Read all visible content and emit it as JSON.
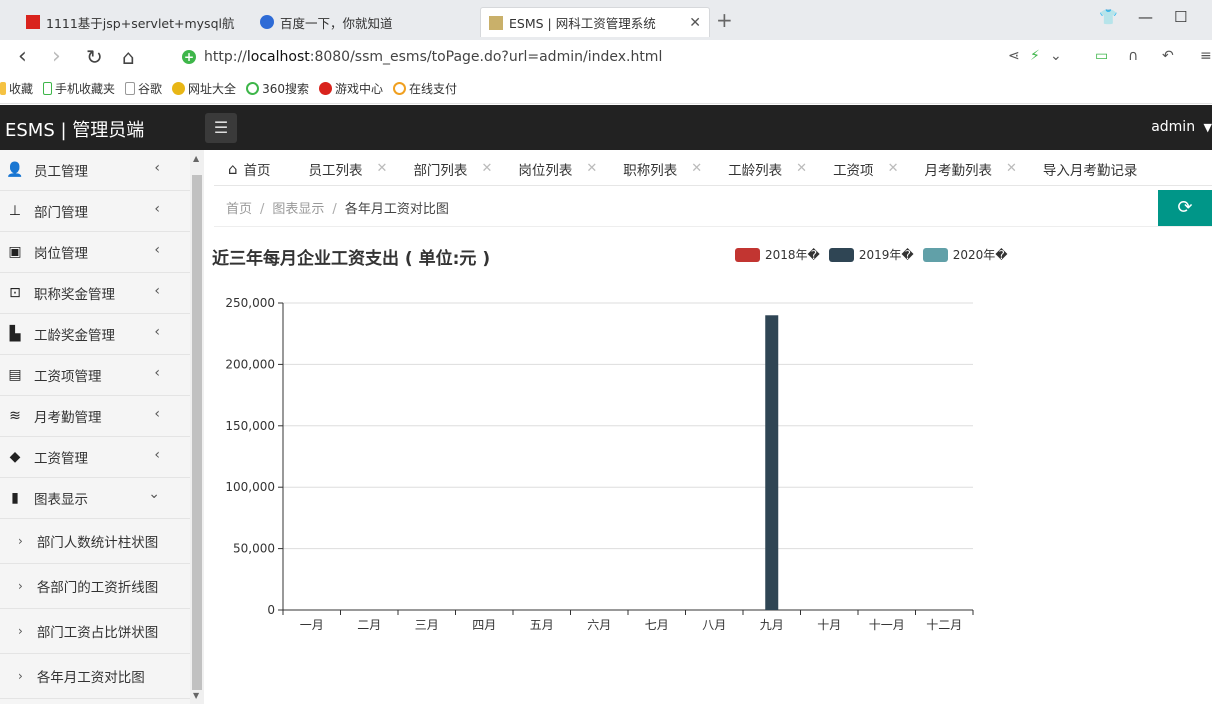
{
  "browser": {
    "tabs": [
      {
        "title": "1111基于jsp+servlet+mysql航"
      },
      {
        "title": "百度一下，你就知道"
      },
      {
        "title": "ESMS | 网科工资管理系统"
      }
    ],
    "url_prefix": "http://",
    "url_host": "localhost",
    "url_rest": ":8080/ssm_esms/toPage.do?url=admin/index.html",
    "bookmarks": [
      "收藏",
      "手机收藏夹",
      "谷歌",
      "网址大全",
      "360搜索",
      "游戏中心",
      "在线支付"
    ]
  },
  "app": {
    "brand": "ESMS | 管理员端",
    "user": "admin"
  },
  "sidebar": {
    "items": [
      {
        "label": "员工管理",
        "icon": "users-icon"
      },
      {
        "label": "部门管理",
        "icon": "sitemap-icon"
      },
      {
        "label": "岗位管理",
        "icon": "id-card-icon"
      },
      {
        "label": "职称奖金管理",
        "icon": "briefcase-icon"
      },
      {
        "label": "工龄奖金管理",
        "icon": "building-icon"
      },
      {
        "label": "工资项管理",
        "icon": "newspaper-icon"
      },
      {
        "label": "月考勤管理",
        "icon": "layers-icon"
      },
      {
        "label": "工资管理",
        "icon": "tag-icon"
      },
      {
        "label": "图表显示",
        "icon": "book-icon"
      }
    ],
    "subitems": [
      "部门人数统计柱状图",
      "各部门的工资折线图",
      "部门工资占比饼状图",
      "各年月工资对比图"
    ]
  },
  "content_tabs": [
    "首页",
    "员工列表",
    "部门列表",
    "岗位列表",
    "职称列表",
    "工龄列表",
    "工资项",
    "月考勤列表",
    "导入月考勤记录"
  ],
  "breadcrumb": {
    "home": "首页",
    "section": "图表显示",
    "current": "各年月工资对比图"
  },
  "chart_data": {
    "type": "bar",
    "title": "近三年每月企业工资支出 ( 单位:元 )",
    "categories": [
      "一月",
      "二月",
      "三月",
      "四月",
      "五月",
      "六月",
      "七月",
      "八月",
      "九月",
      "十月",
      "十一月",
      "十二月"
    ],
    "series": [
      {
        "name": "2018年�",
        "color": "#c23531",
        "values": [
          0,
          0,
          0,
          0,
          0,
          0,
          0,
          0,
          0,
          0,
          0,
          0
        ]
      },
      {
        "name": "2019年�",
        "color": "#2f4554",
        "values": [
          0,
          0,
          0,
          0,
          0,
          0,
          0,
          0,
          240000,
          0,
          0,
          0
        ]
      },
      {
        "name": "2020年�",
        "color": "#61a0a8",
        "values": [
          0,
          0,
          0,
          0,
          0,
          0,
          0,
          0,
          0,
          0,
          0,
          0
        ]
      }
    ],
    "y_ticks": [
      "0",
      "50,000",
      "100,000",
      "150,000",
      "200,000",
      "250,000"
    ],
    "ylim": [
      0,
      250000
    ],
    "grid": true,
    "legend_position": "top-right"
  }
}
